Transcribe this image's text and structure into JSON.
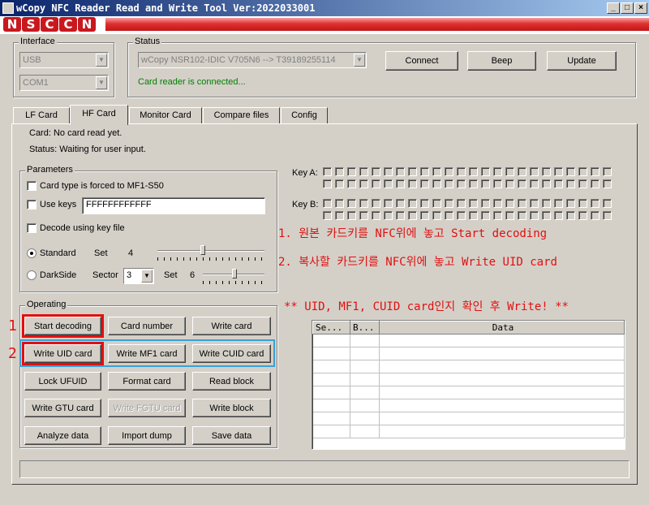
{
  "window": {
    "title": "wCopy NFC Reader Read and Write Tool  Ver:2022033001"
  },
  "banner": {
    "logo": [
      "N",
      "S",
      "C",
      "C",
      "N"
    ]
  },
  "interface": {
    "label": "Interface",
    "type_value": "USB",
    "port_value": "COM1"
  },
  "status": {
    "label": "Status",
    "device_value": "wCopy NSR102-IDIC V705N6 --> T39189255114",
    "message": "Card reader is connected...",
    "message_color": "#008000",
    "connect_label": "Connect",
    "beep_label": "Beep",
    "update_label": "Update"
  },
  "tabs": [
    "LF Card",
    "HF Card",
    "Monitor Card",
    "Compare files",
    "Config"
  ],
  "active_tab": "HF Card",
  "hf": {
    "card_line": "Card: No card read yet.",
    "status_line": "Status: Waiting for user input."
  },
  "parameters": {
    "label": "Parameters",
    "forced_label": "Card type is forced to MF1-S50",
    "use_keys_label": "Use keys",
    "keys_value": "FFFFFFFFFFFF",
    "decode_label": "Decode using key file",
    "standard_label": "Standard",
    "standard_set_label": "Set",
    "standard_set_value": "4",
    "darkside_label": "DarkSide",
    "sector_label": "Sector",
    "sector_value": "3",
    "darkside_set_label": "Set",
    "darkside_set_value": "6"
  },
  "keys": {
    "key_a_label": "Key A:",
    "key_b_label": "Key B:"
  },
  "operating": {
    "label": "Operating",
    "buttons": [
      [
        "Start decoding",
        "Card number",
        "Write card"
      ],
      [
        "Write UID card",
        "Write MF1 card",
        "Write CUID card"
      ],
      [
        "Lock UFUID",
        "Format card",
        "Read block"
      ],
      [
        "Write GTU card",
        "Write FGTU card",
        "Write block"
      ],
      [
        "Analyze data",
        "Import dump",
        "Save data"
      ]
    ]
  },
  "annotations": {
    "step1_num": "1",
    "step2_num": "2",
    "note1": "1. 원본 카드키를 NFC위에 놓고 Start decoding",
    "note2": "2. 복사할 카드키를 NFC위에 놓고 Write UID card",
    "note3": "** UID, MF1, CUID card인지 확인 후 Write! **",
    "color": "#e01010"
  },
  "grid": {
    "columns": [
      "Se...",
      "B...",
      "Data"
    ]
  }
}
